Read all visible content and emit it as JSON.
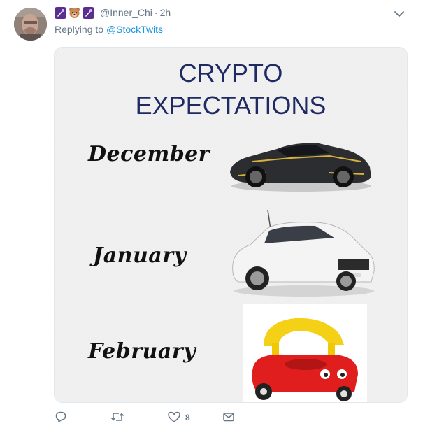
{
  "tweet": {
    "handle": "@Inner_Chi",
    "separator": "·",
    "time": "2h",
    "reply_prefix": "Replying to",
    "reply_to": "@StockTwits",
    "badge_icons": [
      "purple-rocket-badge",
      "bear-face-emoji",
      "purple-rocket-badge"
    ]
  },
  "media": {
    "title_line1": "CRYPTO",
    "title_line2": "EXPECTATIONS",
    "months": [
      "December",
      "January",
      "February"
    ],
    "illustrations": [
      "black-supercar-image",
      "white-hatchback-car-image",
      "toy-ride-on-car-image"
    ],
    "title_color": "#1f2a63"
  },
  "actions": {
    "reply_count": "",
    "retweet_count": "",
    "like_count": "8",
    "dm_count": ""
  },
  "colors": {
    "secondary_text": "#657786",
    "link": "#1b95e0",
    "border": "#e1e8ed"
  }
}
